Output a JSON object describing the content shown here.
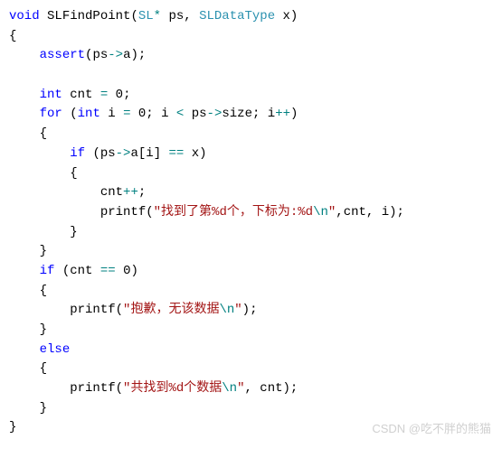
{
  "code": {
    "fn_return": "void",
    "fn_name": "SLFindPoint",
    "param_type1": "SL",
    "param_star": "*",
    "param_name1": "ps",
    "comma1": ",",
    "param_type2": "SLDataType",
    "param_name2": "x",
    "paren_close": ")",
    "brace_open": "{",
    "assert_kw": "assert",
    "assert_arg_open": "(",
    "ps1": "ps",
    "arrow1": "->",
    "a1": "a",
    "assert_arg_close": ")",
    "semi1": ";",
    "int1": "int",
    "cnt_decl": "cnt",
    "eq1": "=",
    "zero1": "0",
    "semi2": ";",
    "for_kw": "for",
    "for_open": "(",
    "int2": "int",
    "i_decl": "i",
    "eq2": "=",
    "zero2": "0",
    "semi3": ";",
    "i1": "i",
    "lt": "<",
    "ps2": "ps",
    "arrow2": "->",
    "size": "size",
    "semi4": ";",
    "i2": "i",
    "incr1": "++",
    "for_close": ")",
    "for_brace_open": "{",
    "if1_kw": "if",
    "if1_open": "(",
    "ps3": "ps",
    "arrow3": "->",
    "a2": "a",
    "bracket_open": "[",
    "i3": "i",
    "bracket_close": "]",
    "eqeq1": "==",
    "x2": "x",
    "if1_close": ")",
    "if1_brace_open": "{",
    "cnt1": "cnt",
    "incr2": "++",
    "semi5": ";",
    "printf1": "printf",
    "p1_open": "(",
    "str1a": "\"找到了第%d个，下标为:%d",
    "str1b": "\\n",
    "str1c": "\"",
    "comma2": ",",
    "cnt2": "cnt",
    "comma3": ",",
    "i4": "i",
    "p1_close": ")",
    "semi6": ";",
    "if1_brace_close": "}",
    "for_brace_close": "}",
    "if2_kw": "if",
    "if2_open": "(",
    "cnt3": "cnt",
    "eqeq2": "==",
    "zero3": "0",
    "if2_close": ")",
    "if2_brace_open": "{",
    "printf2": "printf",
    "p2_open": "(",
    "str2a": "\"抱歉，无该数据",
    "str2b": "\\n",
    "str2c": "\"",
    "p2_close": ")",
    "semi7": ";",
    "if2_brace_close": "}",
    "else_kw": "else",
    "else_brace_open": "{",
    "printf3": "printf",
    "p3_open": "(",
    "str3a": "\"共找到%d个数据",
    "str3b": "\\n",
    "str3c": "\"",
    "comma4": ",",
    "cnt4": "cnt",
    "p3_close": ")",
    "semi8": ";",
    "else_brace_close": "}",
    "brace_close": "}"
  },
  "watermark": "CSDN @吃不胖的熊猫"
}
